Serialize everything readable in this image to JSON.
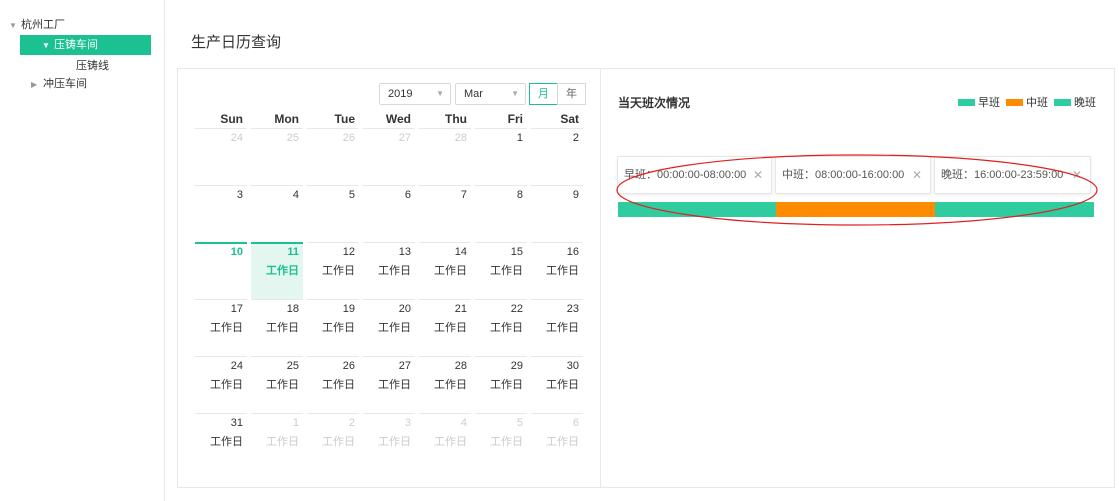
{
  "sidebar": {
    "factory": "杭州工厂",
    "workshop_active": "压铸车间",
    "line": "压铸线",
    "workshop_other": "冲压车间"
  },
  "main": {
    "title": "生产日历查询"
  },
  "calendar": {
    "year": "2019",
    "month": "Mar",
    "mode_month": "月",
    "mode_year": "年",
    "weekdays": [
      "Sun",
      "Mon",
      "Tue",
      "Wed",
      "Thu",
      "Fri",
      "Sat"
    ],
    "workday_label": "工作日",
    "today": 10,
    "selected": 11,
    "weeks": [
      [
        {
          "d": "24",
          "o": true
        },
        {
          "d": "25",
          "o": true
        },
        {
          "d": "26",
          "o": true
        },
        {
          "d": "27",
          "o": true
        },
        {
          "d": "28",
          "o": true
        },
        {
          "d": "1"
        },
        {
          "d": "2"
        }
      ],
      [
        {
          "d": "3"
        },
        {
          "d": "4"
        },
        {
          "d": "5"
        },
        {
          "d": "6"
        },
        {
          "d": "7"
        },
        {
          "d": "8"
        },
        {
          "d": "9"
        }
      ],
      [
        {
          "d": "10"
        },
        {
          "d": "11",
          "w": true
        },
        {
          "d": "12",
          "w": true
        },
        {
          "d": "13",
          "w": true
        },
        {
          "d": "14",
          "w": true
        },
        {
          "d": "15",
          "w": true
        },
        {
          "d": "16",
          "w": true
        }
      ],
      [
        {
          "d": "17",
          "w": true
        },
        {
          "d": "18",
          "w": true
        },
        {
          "d": "19",
          "w": true
        },
        {
          "d": "20",
          "w": true
        },
        {
          "d": "21",
          "w": true
        },
        {
          "d": "22",
          "w": true
        },
        {
          "d": "23",
          "w": true
        }
      ],
      [
        {
          "d": "24",
          "w": true
        },
        {
          "d": "25",
          "w": true
        },
        {
          "d": "26",
          "w": true
        },
        {
          "d": "27",
          "w": true
        },
        {
          "d": "28",
          "w": true
        },
        {
          "d": "29",
          "w": true
        },
        {
          "d": "30",
          "w": true
        }
      ],
      [
        {
          "d": "31",
          "w": true
        },
        {
          "d": "1",
          "o": true,
          "w": true
        },
        {
          "d": "2",
          "o": true,
          "w": true
        },
        {
          "d": "3",
          "o": true,
          "w": true
        },
        {
          "d": "4",
          "o": true,
          "w": true
        },
        {
          "d": "5",
          "o": true,
          "w": true
        },
        {
          "d": "6",
          "o": true,
          "w": true
        }
      ]
    ]
  },
  "shift": {
    "title": "当天班次情况",
    "legend": [
      {
        "label": "早班",
        "color": "#2ecc9e"
      },
      {
        "label": "中班",
        "color": "#ff8c00"
      },
      {
        "label": "晚班",
        "color": "#2ecc9e"
      }
    ],
    "shifts": [
      {
        "label": "早班：00:00:00-08:00:00",
        "color": "#2ecc9e"
      },
      {
        "label": "中班：08:00:00-16:00:00",
        "color": "#ff8c00"
      },
      {
        "label": "晚班：16:00:00-23:59:00",
        "color": "#2ecc9e"
      }
    ],
    "annotation_color": "#e02020"
  },
  "icons": {
    "close": "close-icon",
    "caret_down": "caret-down-icon",
    "caret_right": "caret-right-icon"
  }
}
